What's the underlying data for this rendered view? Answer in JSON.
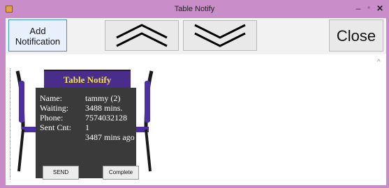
{
  "window": {
    "title": "Table Notify",
    "controls": {
      "minimize": "–",
      "maximize": "▫",
      "close": "✕"
    }
  },
  "toolbar": {
    "add_label": "Add Notification",
    "up_icon": "chevron-up-icon",
    "down_icon": "chevron-down-icon",
    "close_label": "Close"
  },
  "card": {
    "sign_text": "Table Notify",
    "name_label": "Name:",
    "name_value": "tammy (2)",
    "waiting_label": "Waiting:",
    "waiting_value": "3488 mins.",
    "phone_label": "Phone:",
    "phone_value": "7574032128",
    "sent_label": "Sent Cnt:",
    "sent_value": "1",
    "last_sent": "3487 mins ago",
    "send_label": "SEND",
    "complete_label": "Complete"
  },
  "colors": {
    "titlebar": "#c98dc9",
    "sign_bg": "#4a2d8a",
    "sign_text": "#f4e14a",
    "board": "#3a3a3a",
    "chair_seat": "#4b2fa3"
  }
}
